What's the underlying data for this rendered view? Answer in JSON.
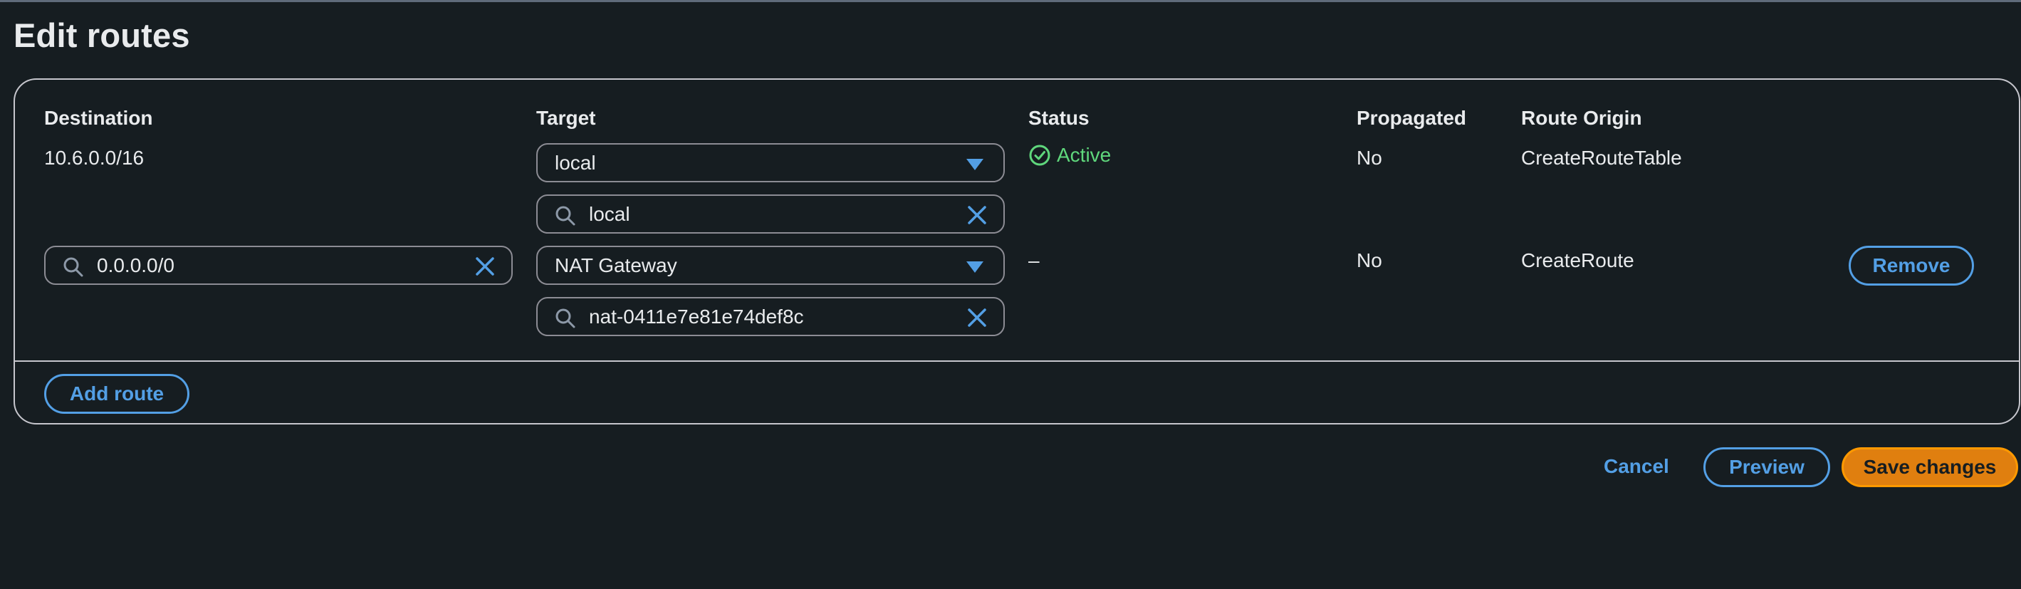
{
  "page": {
    "title": "Edit routes"
  },
  "table": {
    "headers": {
      "destination": "Destination",
      "target": "Target",
      "status": "Status",
      "propagated": "Propagated",
      "route_origin": "Route Origin"
    },
    "rows": [
      {
        "destination": "10.6.0.0/16",
        "target_type": "local",
        "target_value": "local",
        "status": "Active",
        "propagated": "No",
        "route_origin": "CreateRouteTable"
      },
      {
        "destination": "0.0.0.0/0",
        "target_type": "NAT Gateway",
        "target_value": "nat-0411e7e81e74def8c",
        "status": "–",
        "propagated": "No",
        "route_origin": "CreateRoute",
        "remove_label": "Remove"
      }
    ]
  },
  "actions": {
    "add_route": "Add route",
    "cancel": "Cancel",
    "preview": "Preview",
    "save": "Save changes"
  },
  "colors": {
    "background": "#161d21",
    "accent": "#539fe5",
    "primary_button": "#e07f0f",
    "success": "#5fd77c"
  }
}
